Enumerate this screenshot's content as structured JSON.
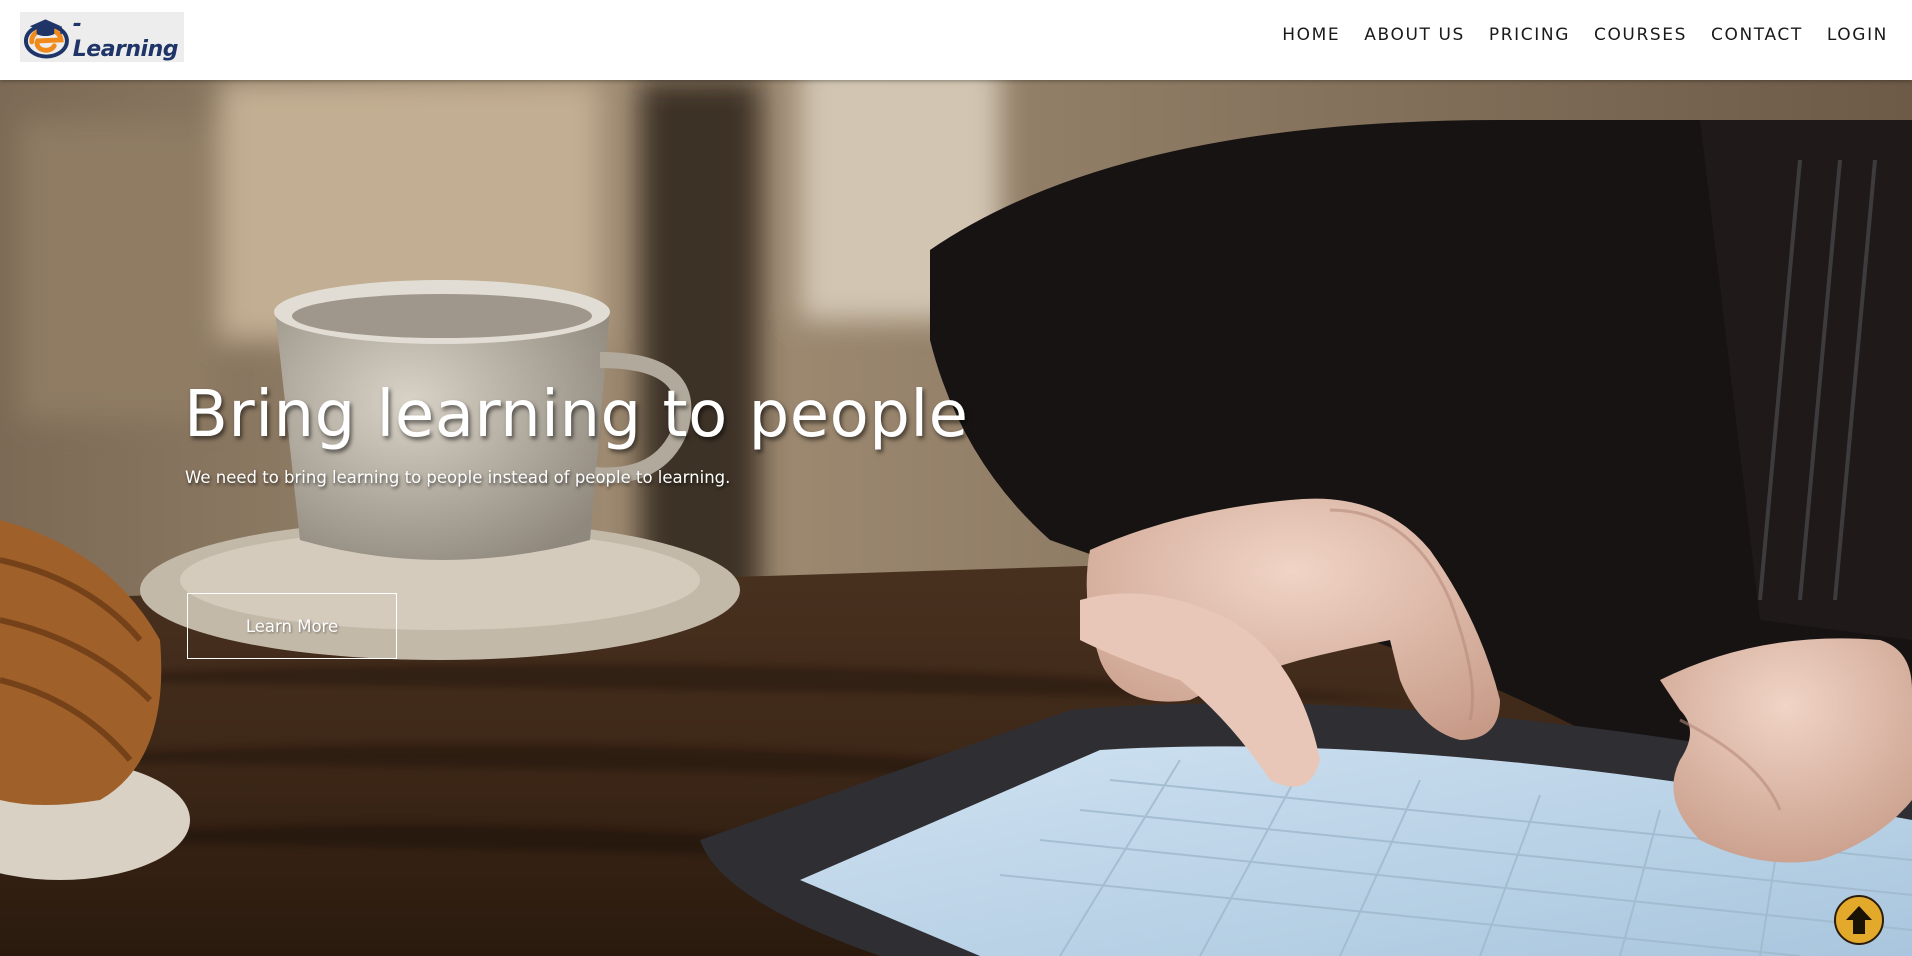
{
  "brand": {
    "logo_text": "-Learning"
  },
  "nav": {
    "items": [
      {
        "label": "HOME"
      },
      {
        "label": "ABOUT US"
      },
      {
        "label": "PRICING"
      },
      {
        "label": "COURSES"
      },
      {
        "label": "CONTACT"
      },
      {
        "label": "LOGIN"
      }
    ]
  },
  "hero": {
    "title": "Bring learning to people",
    "subtitle": "We need to bring learning to people instead of people to learning.",
    "button_label": "Learn More"
  },
  "icons": {
    "logo": "e-learning-logo-icon",
    "scroll_top": "arrow-up-icon"
  },
  "colors": {
    "nav_text": "#1a1a1a",
    "logo_text": "#1f3568",
    "logo_accent": "#f08a1c",
    "scroll_top_bg": "#e3a92a",
    "hero_text": "#ffffff"
  }
}
